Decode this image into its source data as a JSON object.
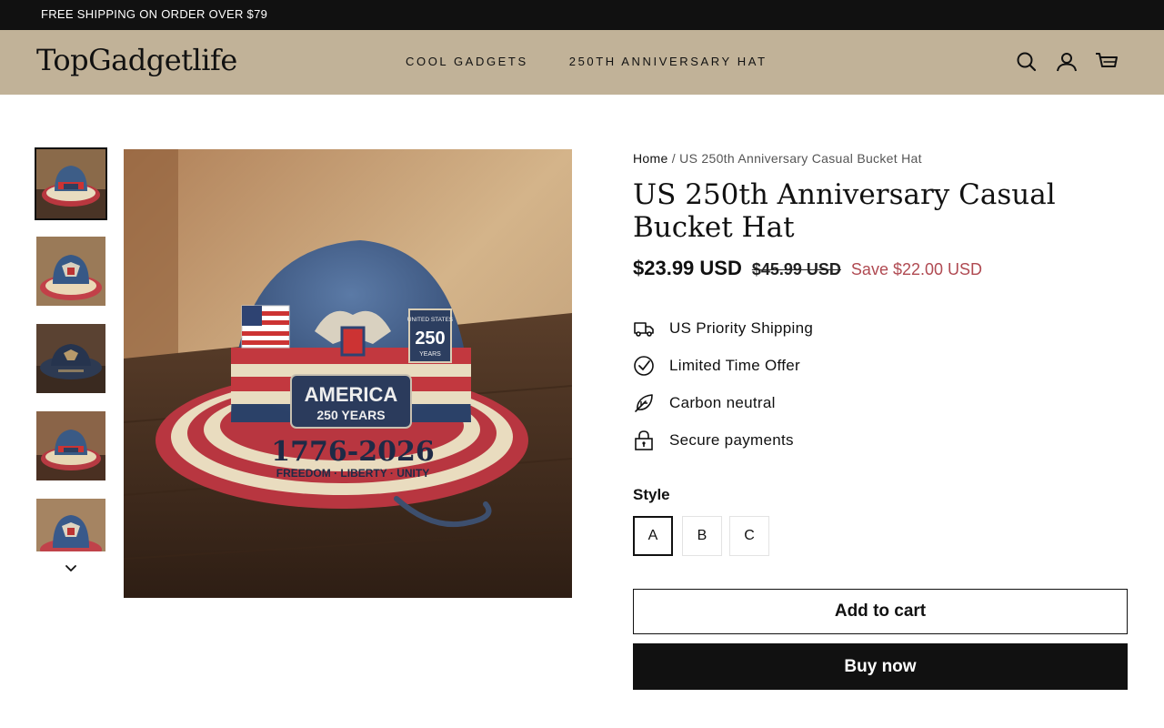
{
  "announcement": {
    "text": "FREE SHIPPING ON ORDER OVER $79"
  },
  "header": {
    "logo": "TopGadgetlife",
    "nav": [
      "COOL GADGETS",
      "250TH ANNIVERSARY HAT"
    ],
    "icons": [
      "search-icon",
      "account-icon",
      "cart-icon"
    ]
  },
  "gallery": {
    "selected_index": 0,
    "main_image": {
      "patch_top": "AMERICA",
      "patch_bottom": "250 YEARS",
      "years": "1776-2026",
      "motto": "FREEDOM · LIBERTY · UNITY",
      "badge_top": "UNITED STATES",
      "badge_num": "250",
      "badge_bottom": "YEARS"
    }
  },
  "product": {
    "breadcrumb": {
      "home": "Home",
      "separator": "/",
      "current": "US 250th Anniversary Casual Bucket Hat"
    },
    "title": "US 250th Anniversary Casual Bucket Hat",
    "price": "$23.99 USD",
    "compare_price": "$45.99 USD",
    "save": "Save $22.00 USD",
    "features": [
      {
        "icon": "truck-icon",
        "label": "US Priority Shipping"
      },
      {
        "icon": "checkmark-circle-icon",
        "label": "Limited Time Offer"
      },
      {
        "icon": "leaf-icon",
        "label": "Carbon neutral"
      },
      {
        "icon": "lock-icon",
        "label": "Secure payments"
      }
    ],
    "style_label": "Style",
    "styles": [
      "A",
      "B",
      "C"
    ],
    "selected_style": "A",
    "add_to_cart": "Add to cart",
    "buy_now": "Buy now"
  },
  "colors": {
    "announcement_bg": "#111111",
    "header_bg": "#c1b298",
    "save_red": "#b04a52",
    "button_dark": "#111111"
  }
}
